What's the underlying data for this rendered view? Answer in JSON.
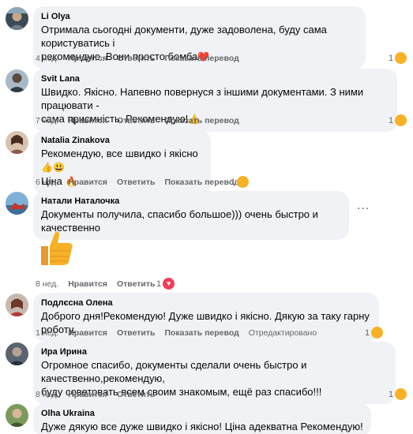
{
  "comments": [
    {
      "author": "Li Olya",
      "text": "Отримала сьогодні документи, дуже задоволена, буду сама користуватись і\nрекомендую. Вони просто бомба",
      "trail_emoji": "❤️",
      "time": "4 нед.",
      "like": "Нравится",
      "reply": "Ответить",
      "translate": "Показать перевод",
      "reactions": "1"
    },
    {
      "author": "Svit Lana",
      "text": "Швидко. Якісно. Напевно повернуся з іншими документами. З ними працювати -\nсама присмність. Рекомендую!",
      "trail_emoji": "👍",
      "time": "7 нед.",
      "like": "Нравится",
      "reply": "Ответить",
      "translate": "Показать перевод",
      "reactions": "1"
    },
    {
      "author": "Natalia Zinakova",
      "text": "Рекомендую, все швидко і якісно",
      "trail_emoji": "👍😃",
      "text2": "Ціна",
      "trail_emoji2": "🔥",
      "time": "6 нед.",
      "like": "Нравится",
      "reply": "Ответить",
      "translate": "Показать перевод",
      "reactions": "1"
    },
    {
      "author": "Натали Наталочка",
      "text": "Документы получила, спасибо большое))) очень быстро и качественно",
      "more": "...",
      "sticker": "👍",
      "time": "8 нед.",
      "like": "Нравится",
      "reply": "Ответить",
      "reactions": "1"
    },
    {
      "author": "Подлєсна Олена",
      "text": "Доброго дня!Рекомендую! Дуже швидко і якісно. Дякую за таку гарну роботу.",
      "time": "1 нед.",
      "like": "Нравится",
      "reply": "Ответить",
      "translate": "Показать перевод",
      "edited": "Отредактировано",
      "reactions": "1"
    },
    {
      "author": "Ира Ирина",
      "text": "Огромное спасибо, документы сделали очень быстро и качественно,рекомендую,\nбуду советовать всем своим знакомым, ещё раз спасибо!!!",
      "time": "8 нед.",
      "like": "Нравится",
      "reply": "Ответить",
      "reactions": "1"
    },
    {
      "author": "Olha Ukraina",
      "text": "Дуже дякую все дуже швидко і якісно! Ціна адекватна Рекомендую!",
      "trail_emoji": "💛💙👍"
    }
  ],
  "colors": {
    "bubble": "#f0f2f5",
    "meta": "#65676b",
    "heart": "#f33e58",
    "care": "#f7b125"
  }
}
